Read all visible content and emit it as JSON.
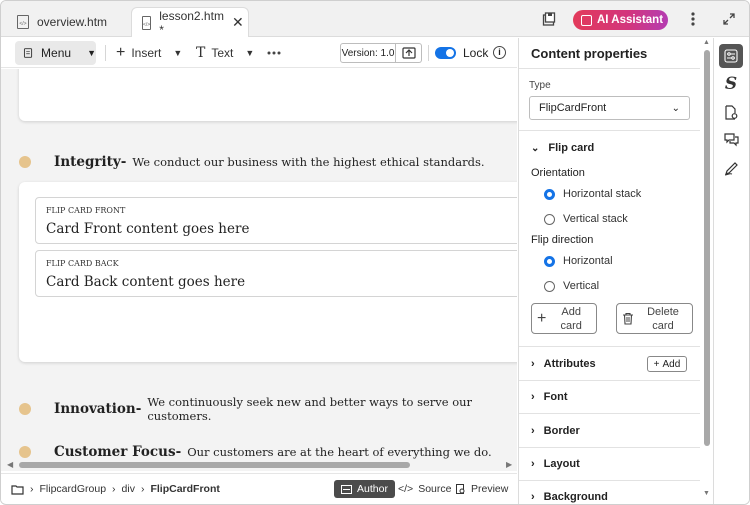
{
  "tabs": [
    {
      "label": "overview.htm",
      "active": false
    },
    {
      "label": "lesson2.htm *",
      "active": true
    }
  ],
  "titlebar": {
    "ai_button_label": "AI Assistant"
  },
  "toolbar": {
    "menu_label": "Menu",
    "insert_label": "Insert",
    "text_label": "Text",
    "version_label": "Version: 1.0",
    "lock_label": "Lock",
    "lock_on": true
  },
  "canvas": {
    "values": [
      {
        "title": "Integrity-",
        "text": "We conduct our business with the highest ethical standards."
      },
      {
        "title": "Innovation-",
        "text": "We continuously seek new and better ways to serve our customers."
      },
      {
        "title": "Customer Focus-",
        "text": "Our customers are at the heart of everything we do."
      }
    ],
    "flip_cards": [
      {
        "label": "FLIP CARD FRONT",
        "content": "Card Front content goes here"
      },
      {
        "label": "FLIP CARD BACK",
        "content": "Card Back content goes here"
      }
    ]
  },
  "statusbar": {
    "breadcrumb": [
      "FlipcardGroup",
      "div",
      "FlipCardFront"
    ],
    "author_label": "Author",
    "source_label": "Source",
    "preview_label": "Preview",
    "active_mode": "Author"
  },
  "panel": {
    "title": "Content properties",
    "type_label": "Type",
    "type_value": "FlipCardFront",
    "flip_card_section": "Flip card",
    "orientation_label": "Orientation",
    "orientation_options": [
      "Horizontal stack",
      "Vertical stack"
    ],
    "orientation_selected": "Horizontal stack",
    "flip_direction_label": "Flip direction",
    "direction_options": [
      "Horizontal",
      "Vertical"
    ],
    "direction_selected": "Horizontal",
    "add_card_label_1": "Add",
    "add_card_label_2": "card",
    "delete_card_label_1": "Delete",
    "delete_card_label_2": "card",
    "sections": [
      "Attributes",
      "Font",
      "Border",
      "Layout",
      "Background"
    ],
    "attributes_add_label": "Add"
  },
  "colors": {
    "accent_blue": "#1473e6",
    "ai_gradient_start": "#e23a5a",
    "ai_gradient_end": "#b43cb2",
    "value_dot": "#e6c48d"
  }
}
